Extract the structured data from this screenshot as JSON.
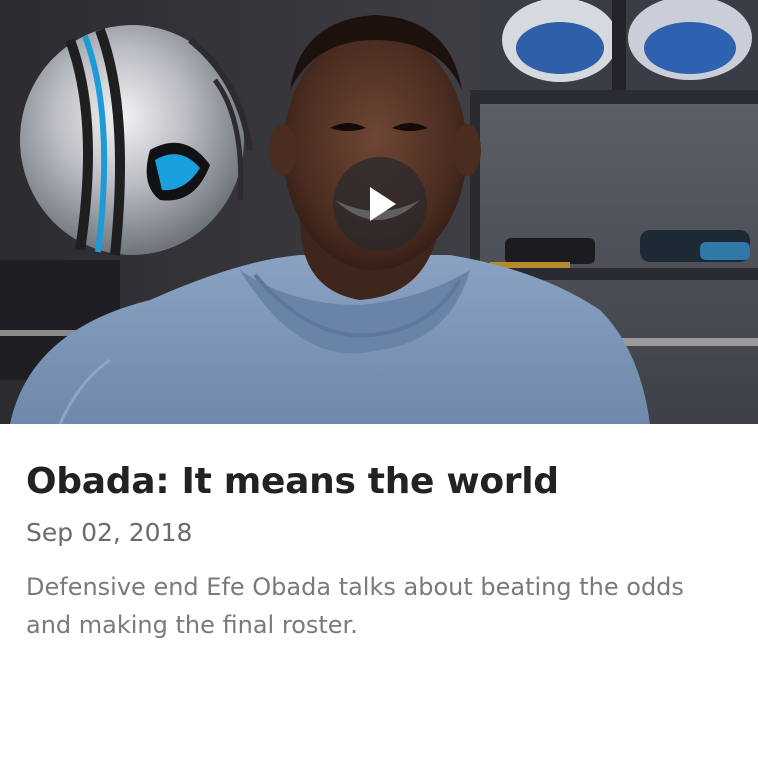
{
  "card": {
    "title": "Obada: It means the world",
    "date": "Sep 02, 2018",
    "description": "Defensive end Efe Obada talks about beating the odds and making the final roster."
  },
  "video": {
    "play_icon": "play-icon",
    "helmet_icon": "helmet-icon"
  },
  "colors": {
    "title": "#222222",
    "date": "#6b6b6b",
    "description": "#7a7a7a",
    "hoodie": "#7b95b8",
    "background": "#ffffff"
  }
}
